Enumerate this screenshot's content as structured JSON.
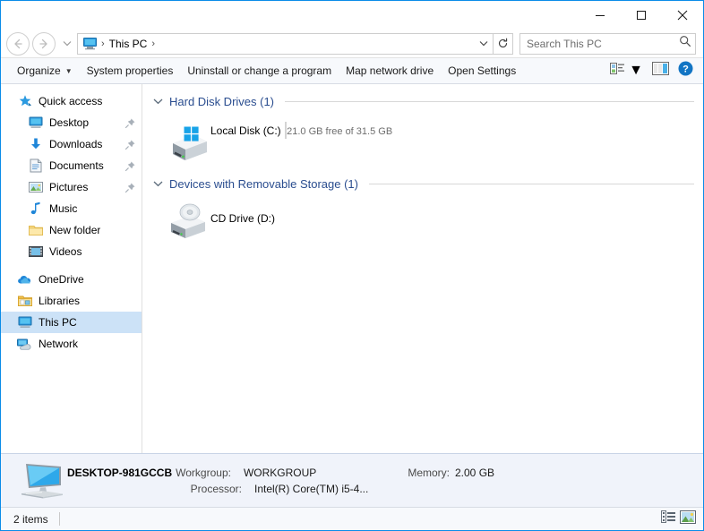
{
  "window": {
    "accent_color": "#0b8ce8",
    "controls": {
      "minimize": "minimize-button",
      "maximize": "maximize-button",
      "close": "close-button"
    }
  },
  "address_bar": {
    "back_label": "Back",
    "forward_label": "Forward",
    "recent_label": "Recent locations",
    "crumb": "This PC",
    "separator": "›",
    "refresh_label": "Refresh"
  },
  "search": {
    "placeholder": "Search This PC",
    "icon": "search-icon"
  },
  "toolbar": {
    "organize": "Organize",
    "organize_caret": "▼",
    "system_properties": "System properties",
    "uninstall": "Uninstall or change a program",
    "map_network_drive": "Map network drive",
    "open_settings": "Open Settings",
    "view_options_icon": "view-options-icon",
    "view_caret": "▼",
    "preview_pane_icon": "preview-pane-icon",
    "help_icon": "help-icon"
  },
  "sidebar": {
    "items": [
      {
        "label": "Quick access",
        "icon": "star-icon",
        "indent": false,
        "pinned": false,
        "selected": false
      },
      {
        "label": "Desktop",
        "icon": "desktop-icon",
        "indent": true,
        "pinned": true,
        "selected": false
      },
      {
        "label": "Downloads",
        "icon": "downloads-icon",
        "indent": true,
        "pinned": true,
        "selected": false
      },
      {
        "label": "Documents",
        "icon": "documents-icon",
        "indent": true,
        "pinned": true,
        "selected": false
      },
      {
        "label": "Pictures",
        "icon": "pictures-icon",
        "indent": true,
        "pinned": true,
        "selected": false
      },
      {
        "label": "Music",
        "icon": "music-icon",
        "indent": true,
        "pinned": false,
        "selected": false
      },
      {
        "label": "New folder",
        "icon": "folder-icon",
        "indent": true,
        "pinned": false,
        "selected": false
      },
      {
        "label": "Videos",
        "icon": "videos-icon",
        "indent": true,
        "pinned": false,
        "selected": false
      },
      {
        "label": "OneDrive",
        "icon": "onedrive-icon",
        "indent": false,
        "pinned": false,
        "selected": false
      },
      {
        "label": "Libraries",
        "icon": "libraries-icon",
        "indent": false,
        "pinned": false,
        "selected": false
      },
      {
        "label": "This PC",
        "icon": "this-pc-icon",
        "indent": false,
        "pinned": false,
        "selected": true
      },
      {
        "label": "Network",
        "icon": "network-icon",
        "indent": false,
        "pinned": false,
        "selected": false
      }
    ]
  },
  "content": {
    "groups": [
      {
        "title": "Hard Disk Drives (1)",
        "chevron": "chevron-down-icon",
        "items": [
          {
            "name": "Local Disk (C:)",
            "icon": "windows-drive-icon",
            "capacity_text": "21.0 GB free of 31.5 GB",
            "free_gb": 21.0,
            "total_gb": 31.5,
            "used_percent": 33,
            "bar_fill_color": "#26a0da"
          }
        ]
      },
      {
        "title": "Devices with Removable Storage (1)",
        "chevron": "chevron-down-icon",
        "items": [
          {
            "name": "CD Drive (D:)",
            "icon": "cd-drive-icon",
            "capacity_text": "",
            "used_percent": 0
          }
        ]
      }
    ]
  },
  "details_pane": {
    "icon": "computer-icon",
    "computer_name": "DESKTOP-981GCCB",
    "fields": [
      {
        "label": "Workgroup:",
        "value": "WORKGROUP"
      },
      {
        "label": "Processor:",
        "value": "Intel(R) Core(TM) i5-4..."
      }
    ],
    "memory_label": "Memory:",
    "memory_value": "2.00 GB"
  },
  "status_bar": {
    "item_count": "2 items",
    "details_view_icon": "details-view-icon",
    "tiles_view_icon": "large-icons-view-icon"
  }
}
